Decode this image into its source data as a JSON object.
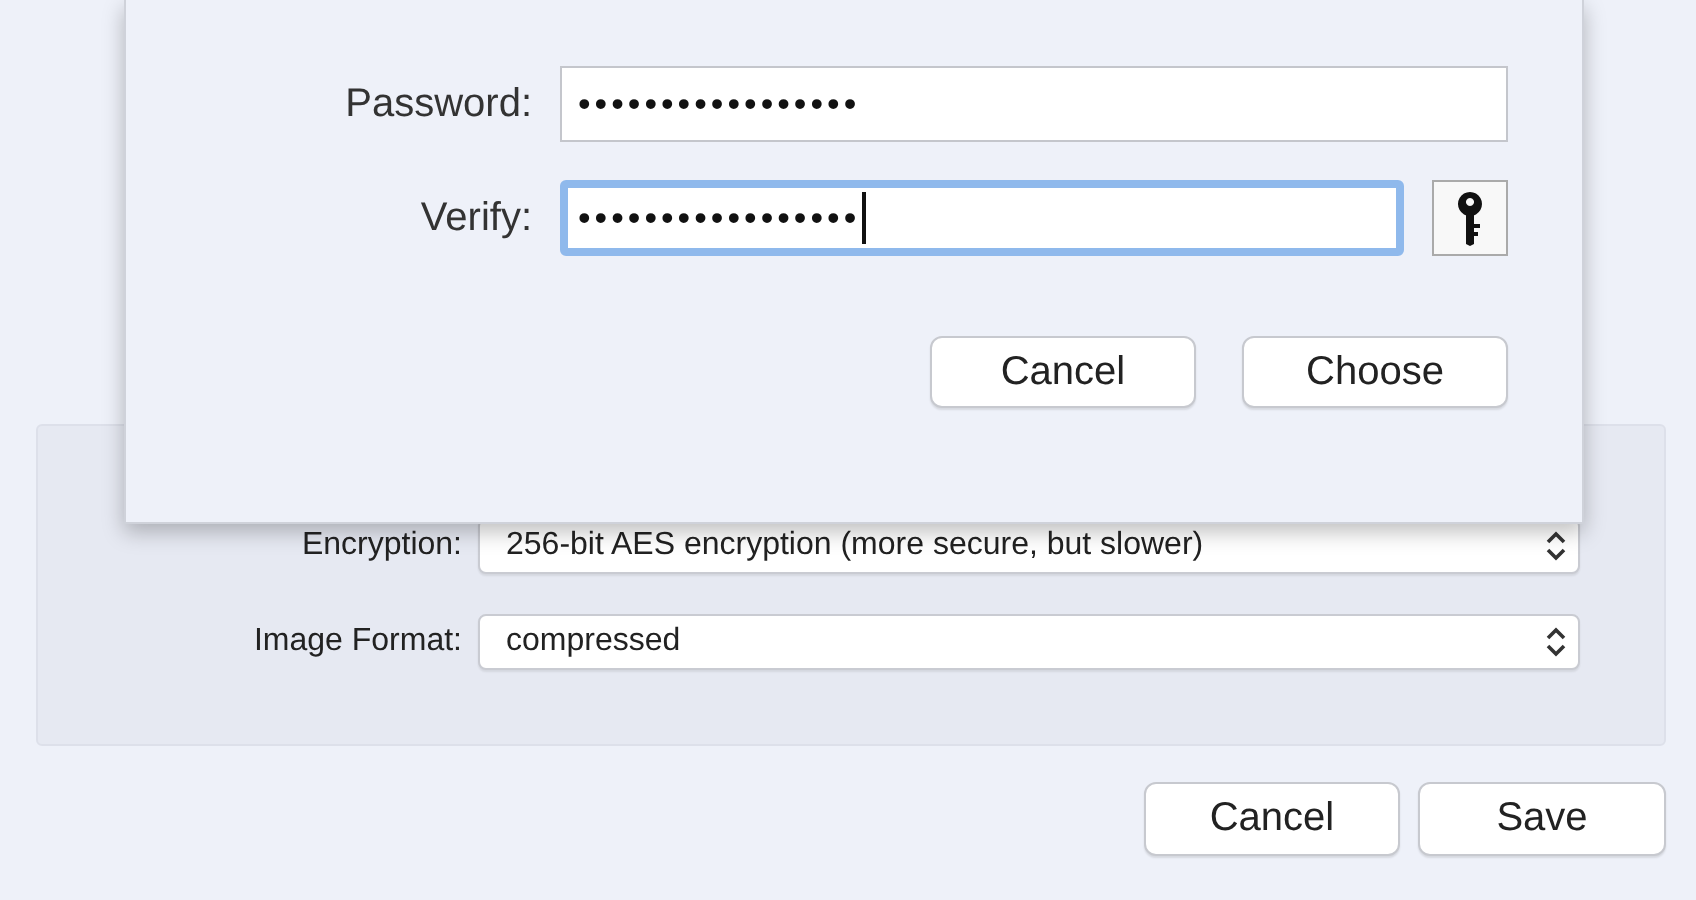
{
  "sheet": {
    "fields": [
      {
        "label": "Password:",
        "value": "•••••••••••••••••",
        "focused": false,
        "kind": "plain"
      },
      {
        "label": "Verify:",
        "value": "•••••••••••••••••",
        "focused": true,
        "kind": "with_key"
      }
    ],
    "buttons": [
      "Cancel",
      "Choose"
    ]
  },
  "settings": {
    "rows": [
      {
        "label": "Encryption:",
        "value": "256-bit AES encryption (more secure, but slower)"
      },
      {
        "label": "Image Format:",
        "value": "compressed"
      }
    ]
  },
  "buttons": [
    "Cancel",
    "Save"
  ]
}
